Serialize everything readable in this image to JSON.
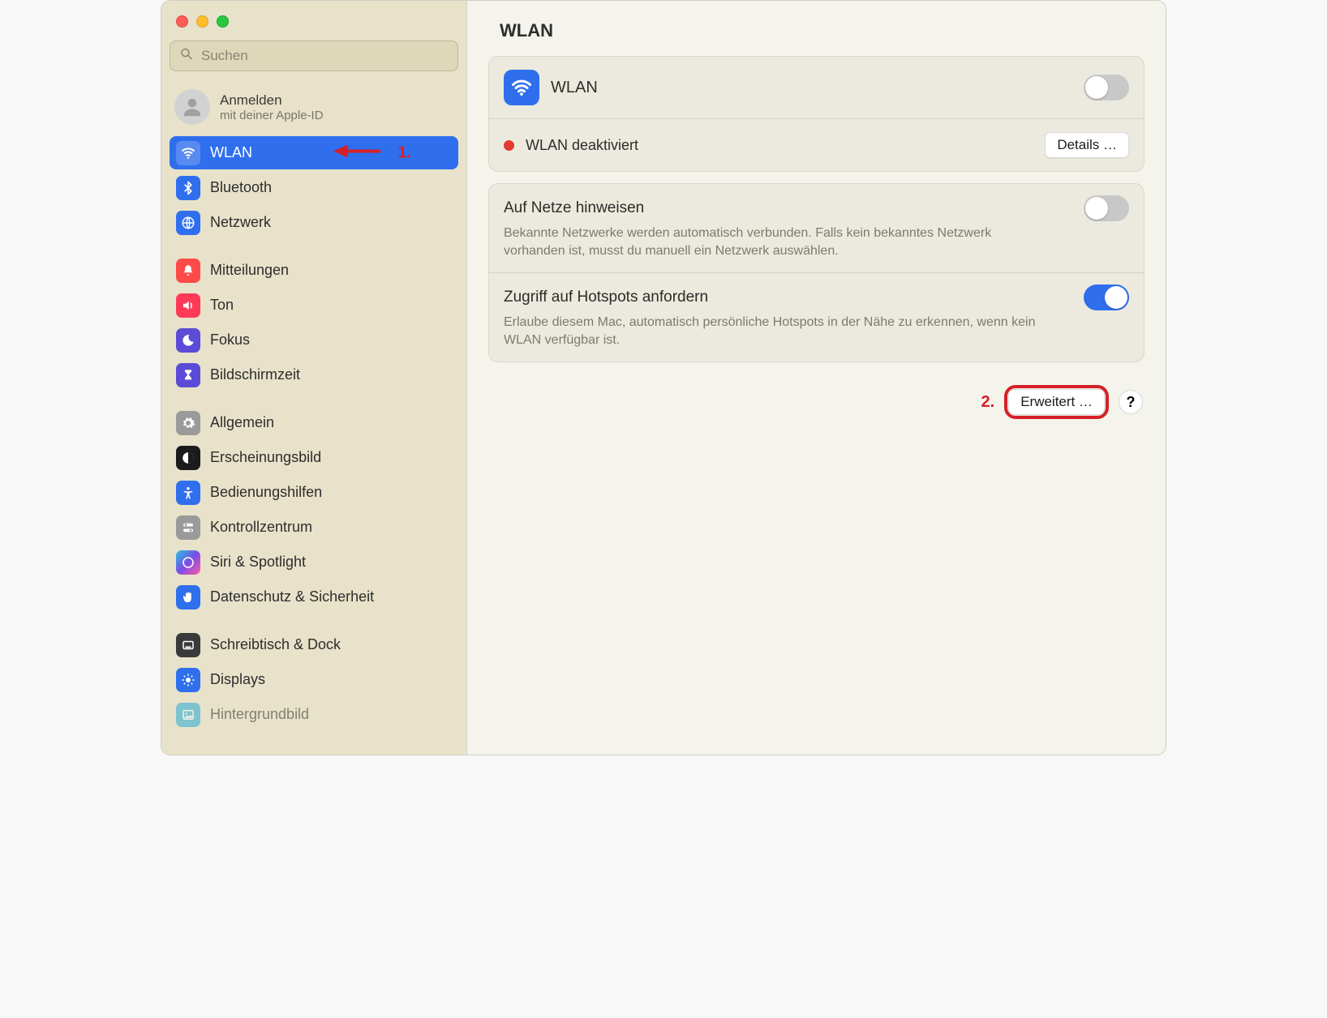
{
  "window": {
    "search_placeholder": "Suchen"
  },
  "account": {
    "title": "Anmelden",
    "subtitle": "mit deiner Apple-ID"
  },
  "sidebar": {
    "items": [
      {
        "label": "WLAN",
        "selected": true
      },
      {
        "label": "Bluetooth"
      },
      {
        "label": "Netzwerk"
      },
      {
        "label": "Mitteilungen"
      },
      {
        "label": "Ton"
      },
      {
        "label": "Fokus"
      },
      {
        "label": "Bildschirmzeit"
      },
      {
        "label": "Allgemein"
      },
      {
        "label": "Erscheinungsbild"
      },
      {
        "label": "Bedienungshilfen"
      },
      {
        "label": "Kontrollzentrum"
      },
      {
        "label": "Siri & Spotlight"
      },
      {
        "label": "Datenschutz & Sicherheit"
      },
      {
        "label": "Schreibtisch & Dock"
      },
      {
        "label": "Displays"
      },
      {
        "label": "Hintergrundbild"
      }
    ]
  },
  "annotations": {
    "step1": "1.",
    "step2": "2."
  },
  "main": {
    "title": "WLAN",
    "wlan": {
      "label": "WLAN",
      "enabled": false,
      "status_text": "WLAN deaktiviert",
      "details_button": "Details …"
    },
    "notify": {
      "title": "Auf Netze hinweisen",
      "desc": "Bekannte Netzwerke werden automatisch verbunden. Falls kein bekanntes Netzwerk vorhanden ist, musst du manuell ein Netzwerk auswählen.",
      "enabled": false
    },
    "hotspot": {
      "title": "Zugriff auf Hotspots anfordern",
      "desc": "Erlaube diesem Mac, automatisch persönliche Hotspots in der Nähe zu erkennen, wenn kein WLAN verfügbar ist.",
      "enabled": true
    },
    "advanced_button": "Erweitert …",
    "help_label": "?"
  }
}
